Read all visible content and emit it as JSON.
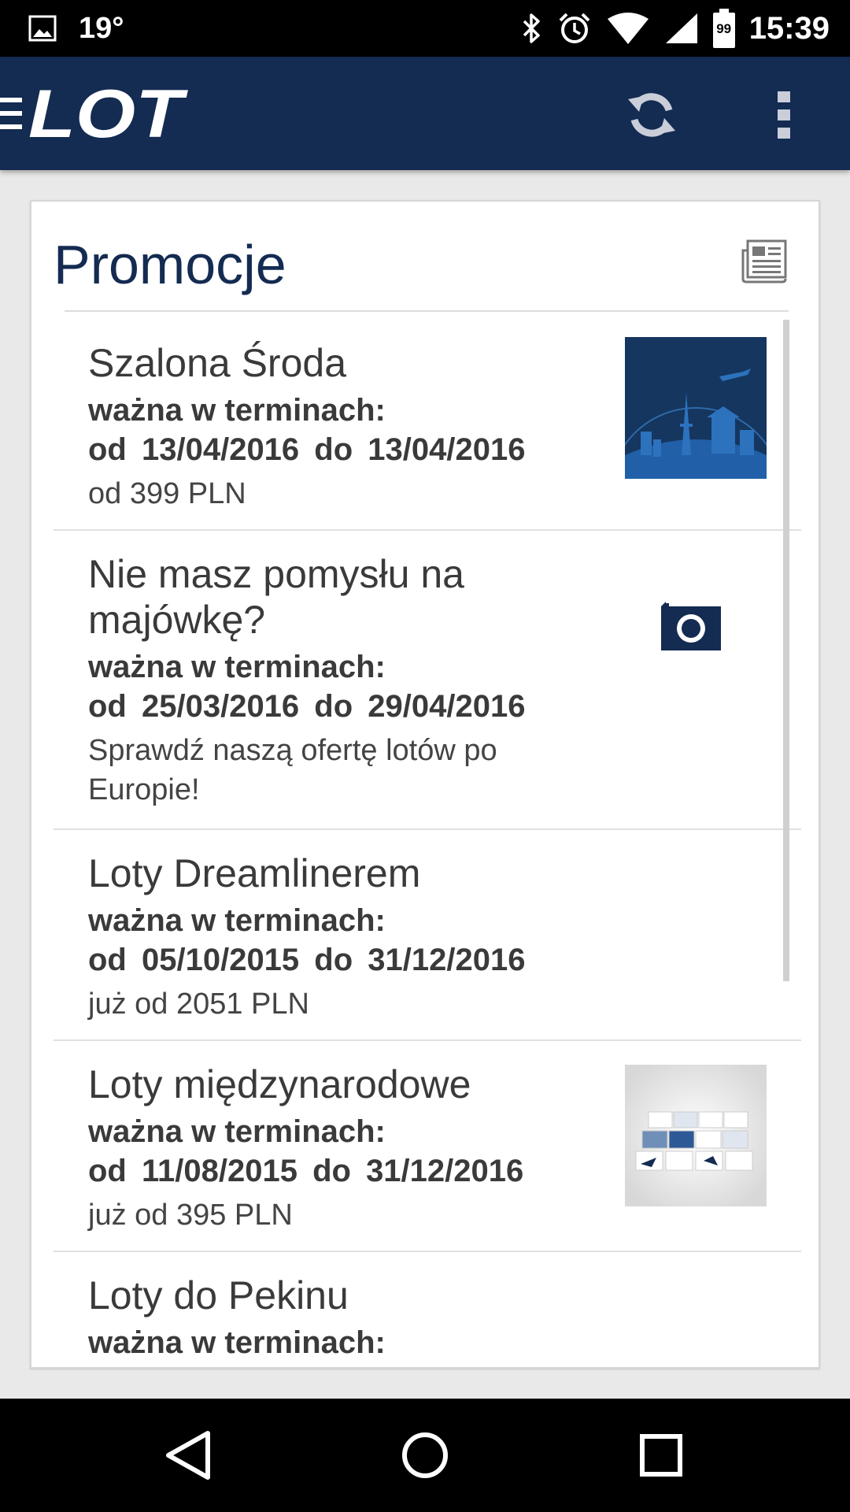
{
  "status_bar": {
    "temperature": "19°",
    "battery": "99",
    "time": "15:39"
  },
  "app_bar": {
    "logo_text": "LOT",
    "brand_color": "#142b52"
  },
  "card": {
    "title": "Promocje",
    "items": [
      {
        "title": "Szalona Środa",
        "validity_label": "ważna w terminach:",
        "dates": "od 13/04/2016 do 13/04/2016",
        "description": "od 399 PLN",
        "thumbnail": "globe-landmarks-image"
      },
      {
        "title": "Nie masz pomysłu na majówkę?",
        "validity_label": "ważna w terminach:",
        "dates": "od 25/03/2016 do 29/04/2016",
        "description": "Sprawdź naszą ofertę lotów po Europie!",
        "thumbnail": "camera-icon"
      },
      {
        "title": "Loty Dreamlinerem",
        "validity_label": "ważna w terminach:",
        "dates": "od 05/10/2015 do 31/12/2016",
        "description": "już od 2051 PLN",
        "thumbnail": ""
      },
      {
        "title": "Loty międzynarodowe",
        "validity_label": "ważna w terminach:",
        "dates": "od 11/08/2015 do 31/12/2016",
        "description": "już od 395 PLN",
        "thumbnail": "cards-image"
      },
      {
        "title": "Loty do Pekinu",
        "validity_label": "ważna w terminach:",
        "dates": "",
        "description": "",
        "thumbnail": ""
      }
    ]
  }
}
